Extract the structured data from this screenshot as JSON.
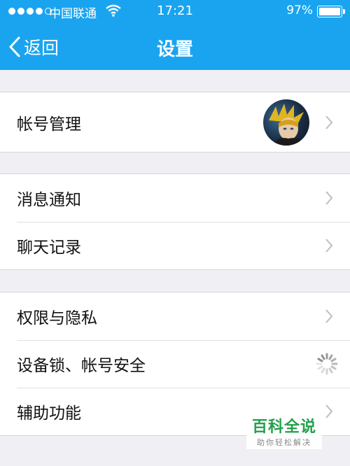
{
  "status_bar": {
    "carrier": "中国联通",
    "time": "17:21",
    "battery_percent": "97%"
  },
  "nav": {
    "back_label": "返回",
    "title": "设置"
  },
  "groups": [
    {
      "items": [
        {
          "label": "帐号管理",
          "accessory": "avatar"
        }
      ]
    },
    {
      "items": [
        {
          "label": "消息通知",
          "accessory": "chevron"
        },
        {
          "label": "聊天记录",
          "accessory": "chevron"
        }
      ]
    },
    {
      "items": [
        {
          "label": "权限与隐私",
          "accessory": "chevron"
        },
        {
          "label": "设备锁、帐号安全",
          "accessory": "loading-spinner"
        },
        {
          "label": "辅助功能",
          "accessory": "chevron"
        }
      ]
    }
  ],
  "watermark": {
    "title": "百科全说",
    "subtitle": "助你轻松解决"
  },
  "colors": {
    "header": "#1aa4f0",
    "background": "#efeff4",
    "chevron": "#bdbdc2",
    "watermark": "#22a04b"
  }
}
